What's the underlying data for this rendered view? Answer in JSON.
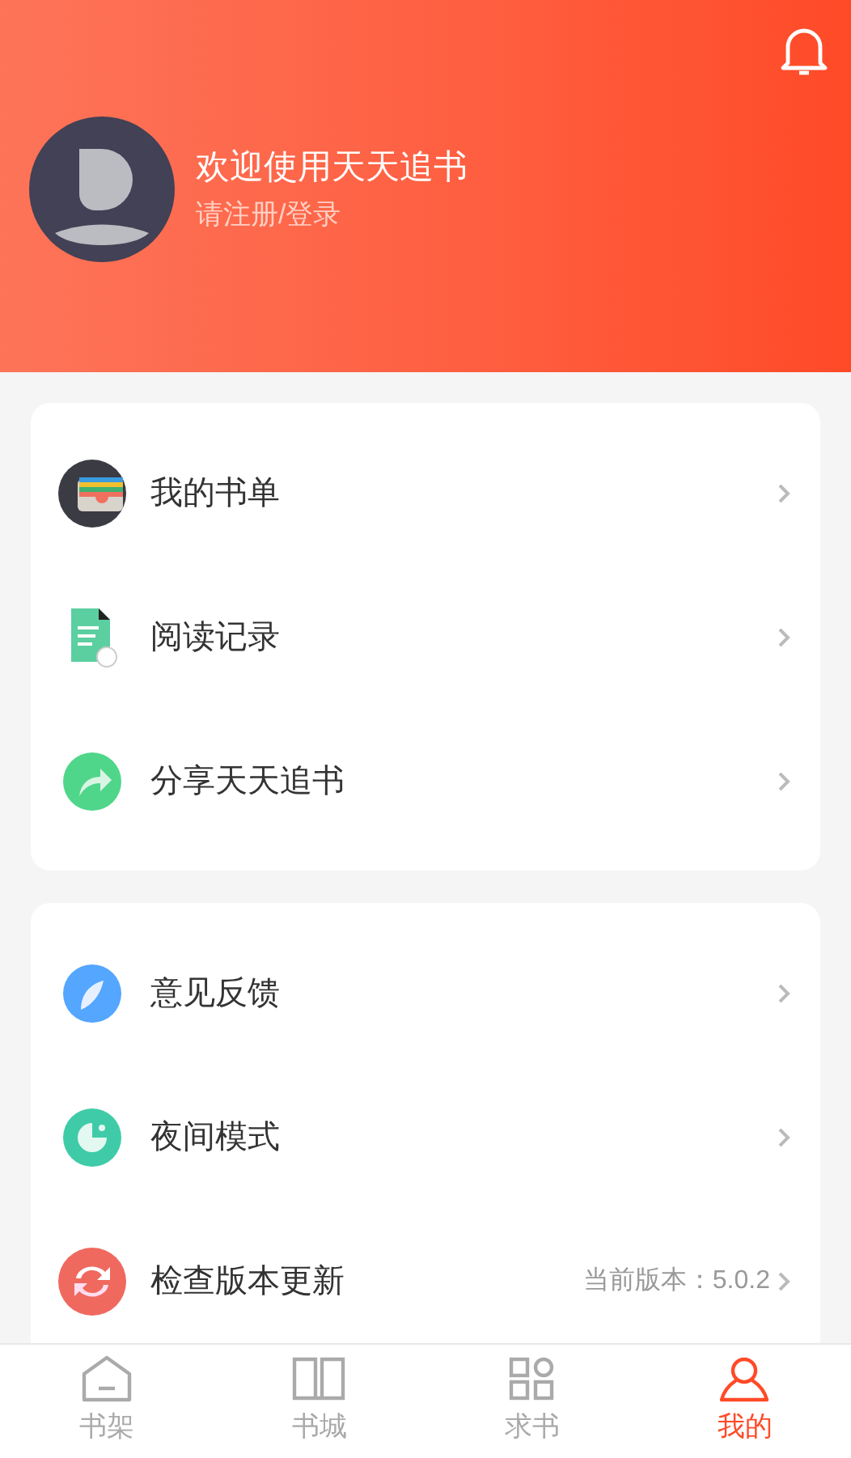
{
  "header": {
    "title": "欢迎使用天天追书",
    "subtitle": "请注册/登录"
  },
  "menu_groups": [
    {
      "items": [
        {
          "kind": "wallet",
          "label": "我的书单"
        },
        {
          "kind": "document",
          "label": "阅读记录"
        },
        {
          "kind": "share",
          "label": "分享天天追书"
        }
      ]
    },
    {
      "items": [
        {
          "kind": "feather",
          "label": "意见反馈"
        },
        {
          "kind": "night",
          "label": "夜间模式"
        },
        {
          "kind": "update",
          "label": "检查版本更新",
          "value": "当前版本：5.0.2"
        }
      ]
    }
  ],
  "tabs": [
    {
      "kind": "shelf",
      "label": "书架",
      "selected": false
    },
    {
      "kind": "store",
      "label": "书城",
      "selected": false
    },
    {
      "kind": "request",
      "label": "求书",
      "selected": false
    },
    {
      "kind": "me",
      "label": "我的",
      "selected": true
    }
  ]
}
